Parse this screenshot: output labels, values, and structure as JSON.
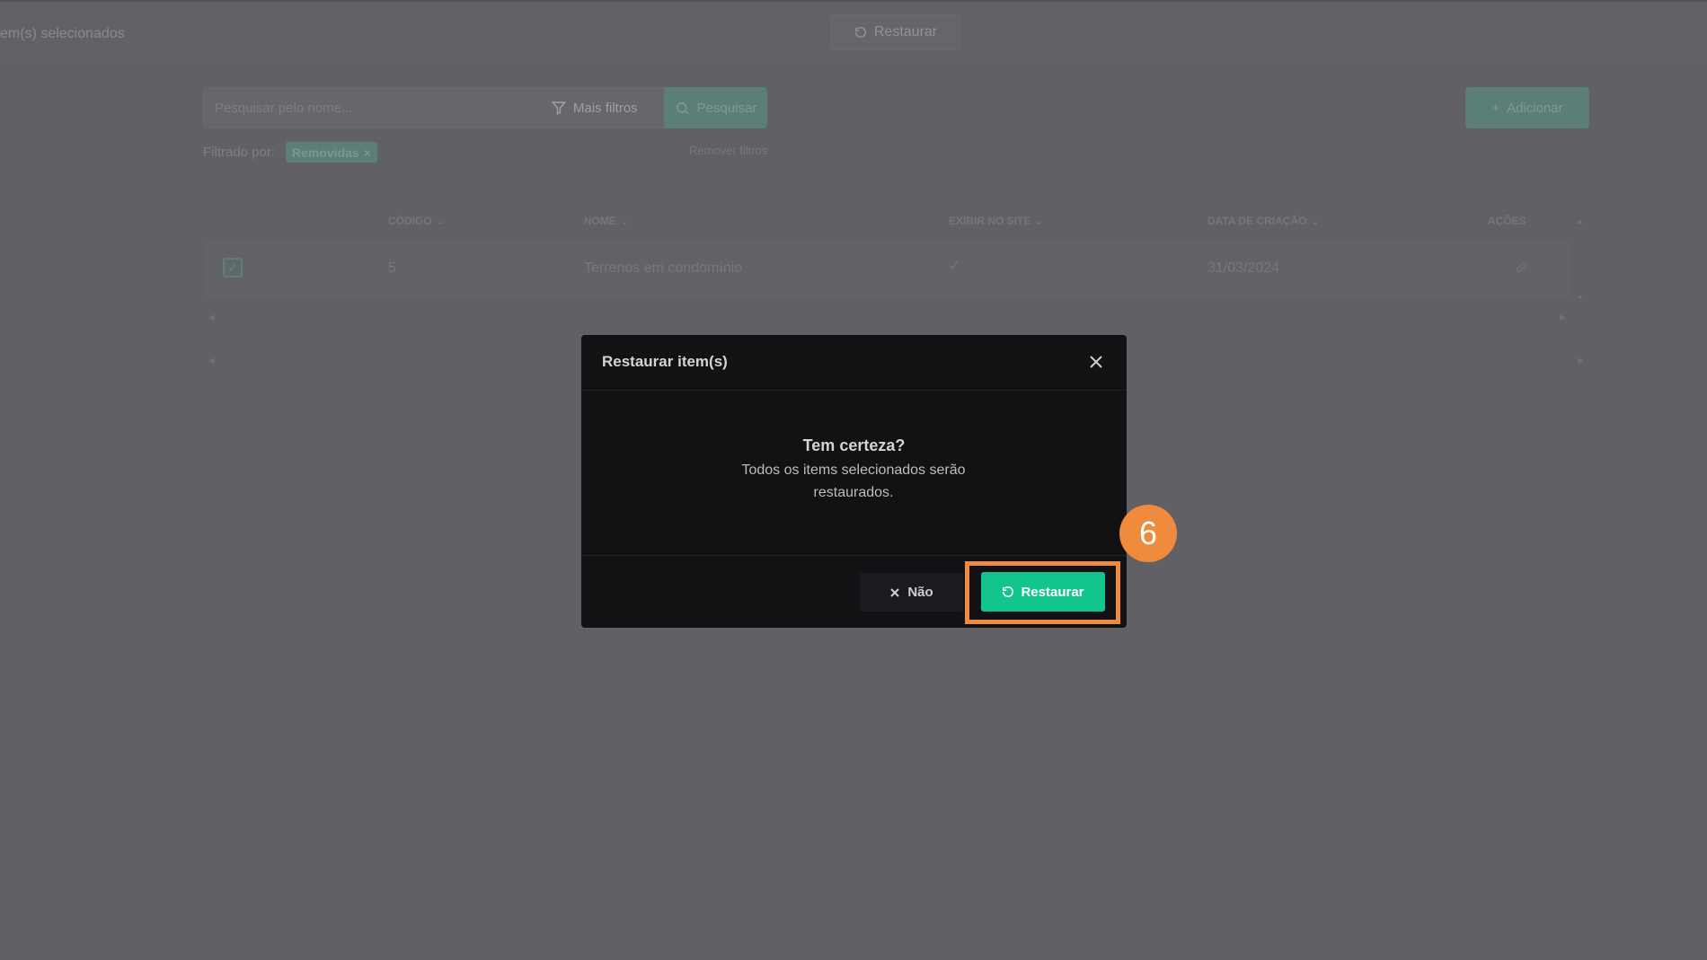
{
  "topbar": {
    "selected_text": "em(s) selecionados",
    "restore_label": "Restaurar"
  },
  "search": {
    "placeholder": "Pesquisar pelo nome...",
    "more_filters_label": "Mais filtros",
    "search_button_label": "Pesquisar"
  },
  "add_button_label": "Adicionar",
  "filters": {
    "filtered_by_label": "Filtrado por:",
    "active_tag": "Removidas",
    "remove_filters_label": "Remover filtros"
  },
  "table": {
    "columns": [
      "CÓDIGO",
      "NOME",
      "EXIBIR NO SITE",
      "DATA DE CRIAÇÃO",
      "AÇÕES"
    ],
    "rows": [
      {
        "codigo": "5",
        "nome": "Terrenos em condomínio",
        "exibir_no_site": "✓",
        "data_criacao": "31/03/2024",
        "selected": true
      }
    ]
  },
  "modal": {
    "title": "Restaurar item(s)",
    "confirm_title": "Tem certeza?",
    "confirm_text": "Todos os items selecionados serão restaurados.",
    "no_label": "Não",
    "restore_label": "Restaurar"
  },
  "annotation": {
    "step_number": "6",
    "color": "#f08a3c"
  },
  "colors": {
    "accent": "#12c48d",
    "modal_bg": "#121215"
  }
}
